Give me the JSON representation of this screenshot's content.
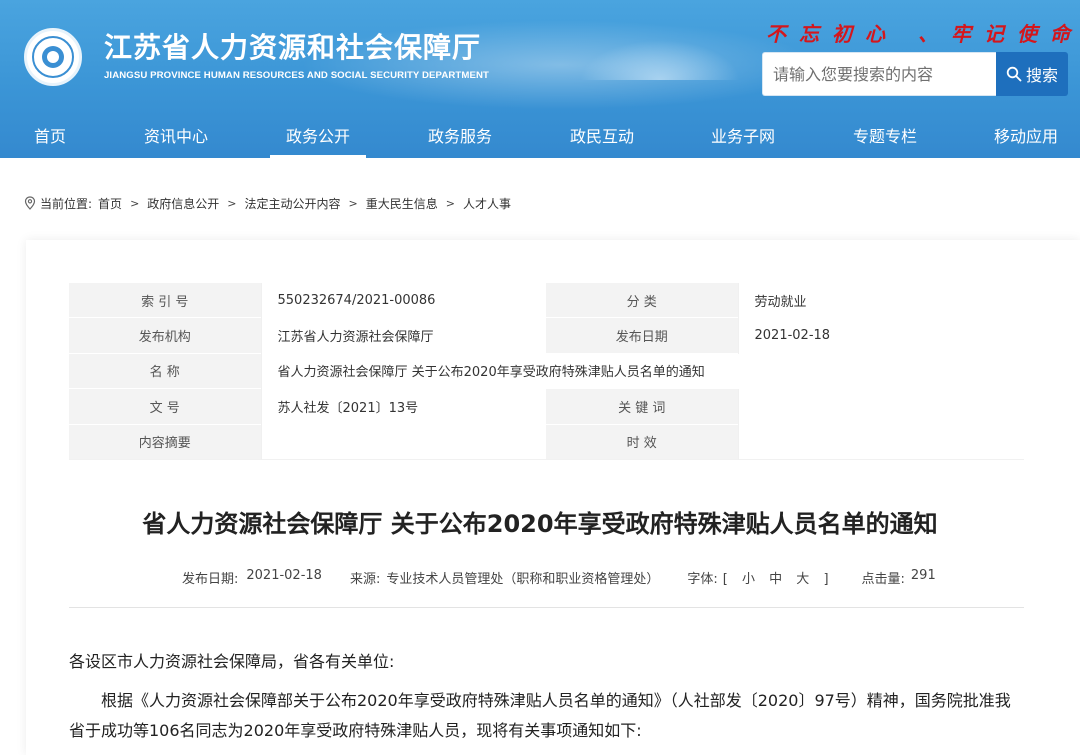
{
  "header": {
    "title": "江苏省人力资源和社会保障厅",
    "subtitle": "JIANGSU PROVINCE HUMAN RESOURCES AND SOCIAL SECURITY DEPARTMENT",
    "slogan": "不忘初心 、牢记使命",
    "search": {
      "placeholder": "请输入您要搜索的内容",
      "button_label": "搜索"
    }
  },
  "nav": [
    {
      "label": "首页"
    },
    {
      "label": "资讯中心"
    },
    {
      "label": "政务公开"
    },
    {
      "label": "政务服务"
    },
    {
      "label": "政民互动"
    },
    {
      "label": "业务子网"
    },
    {
      "label": "专题专栏"
    },
    {
      "label": "移动应用"
    }
  ],
  "breadcrumb": {
    "prefix": "当前位置:",
    "items": [
      "首页",
      "政府信息公开",
      "法定主动公开内容",
      "重大民生信息",
      "人才人事"
    ]
  },
  "meta": {
    "index_label": "索 引 号",
    "index_value": "550232674/2021-00086",
    "category_label": "分 类",
    "category_value": "劳动就业",
    "org_label": "发布机构",
    "org_value": "江苏省人力资源社会保障厅",
    "date_label": "发布日期",
    "date_value": "2021-02-18",
    "name_label": "名 称",
    "name_value": "省人力资源社会保障厅 关于公布2020年享受政府特殊津贴人员名单的通知",
    "doc_label": "文 号",
    "doc_value": "苏人社发〔2021〕13号",
    "keyword_label": "关 键 词",
    "keyword_value": "",
    "summary_label": "内容摘要",
    "summary_value": "",
    "validity_label": "时 效",
    "validity_value": ""
  },
  "article": {
    "title": "省人力资源社会保障厅 关于公布2020年享受政府特殊津贴人员名单的通知",
    "publish_label": "发布日期:",
    "publish_date": "2021-02-18",
    "source_label": "来源:",
    "source_value": "专业技术人员管理处（职称和职业资格管理处）",
    "font_label": "字体:",
    "font_open": "[",
    "font_small": "小",
    "font_medium": "中",
    "font_large": "大",
    "font_close": "]",
    "clicks_label": "点击量:",
    "clicks_value": "291",
    "salutation": "各设区市人力资源社会保障局，省各有关单位:",
    "paragraph": "根据《人力资源社会保障部关于公布2020年享受政府特殊津贴人员名单的通知》（人社部发〔2020〕97号）精神，国务院批准我省于成功等106名同志为2020年享受政府特殊津贴人员，现将有关事项通知如下:"
  },
  "colors": {
    "header_blue": "#3b95d6",
    "slogan_red": "#d4161c",
    "search_button": "#1e6fbd"
  }
}
